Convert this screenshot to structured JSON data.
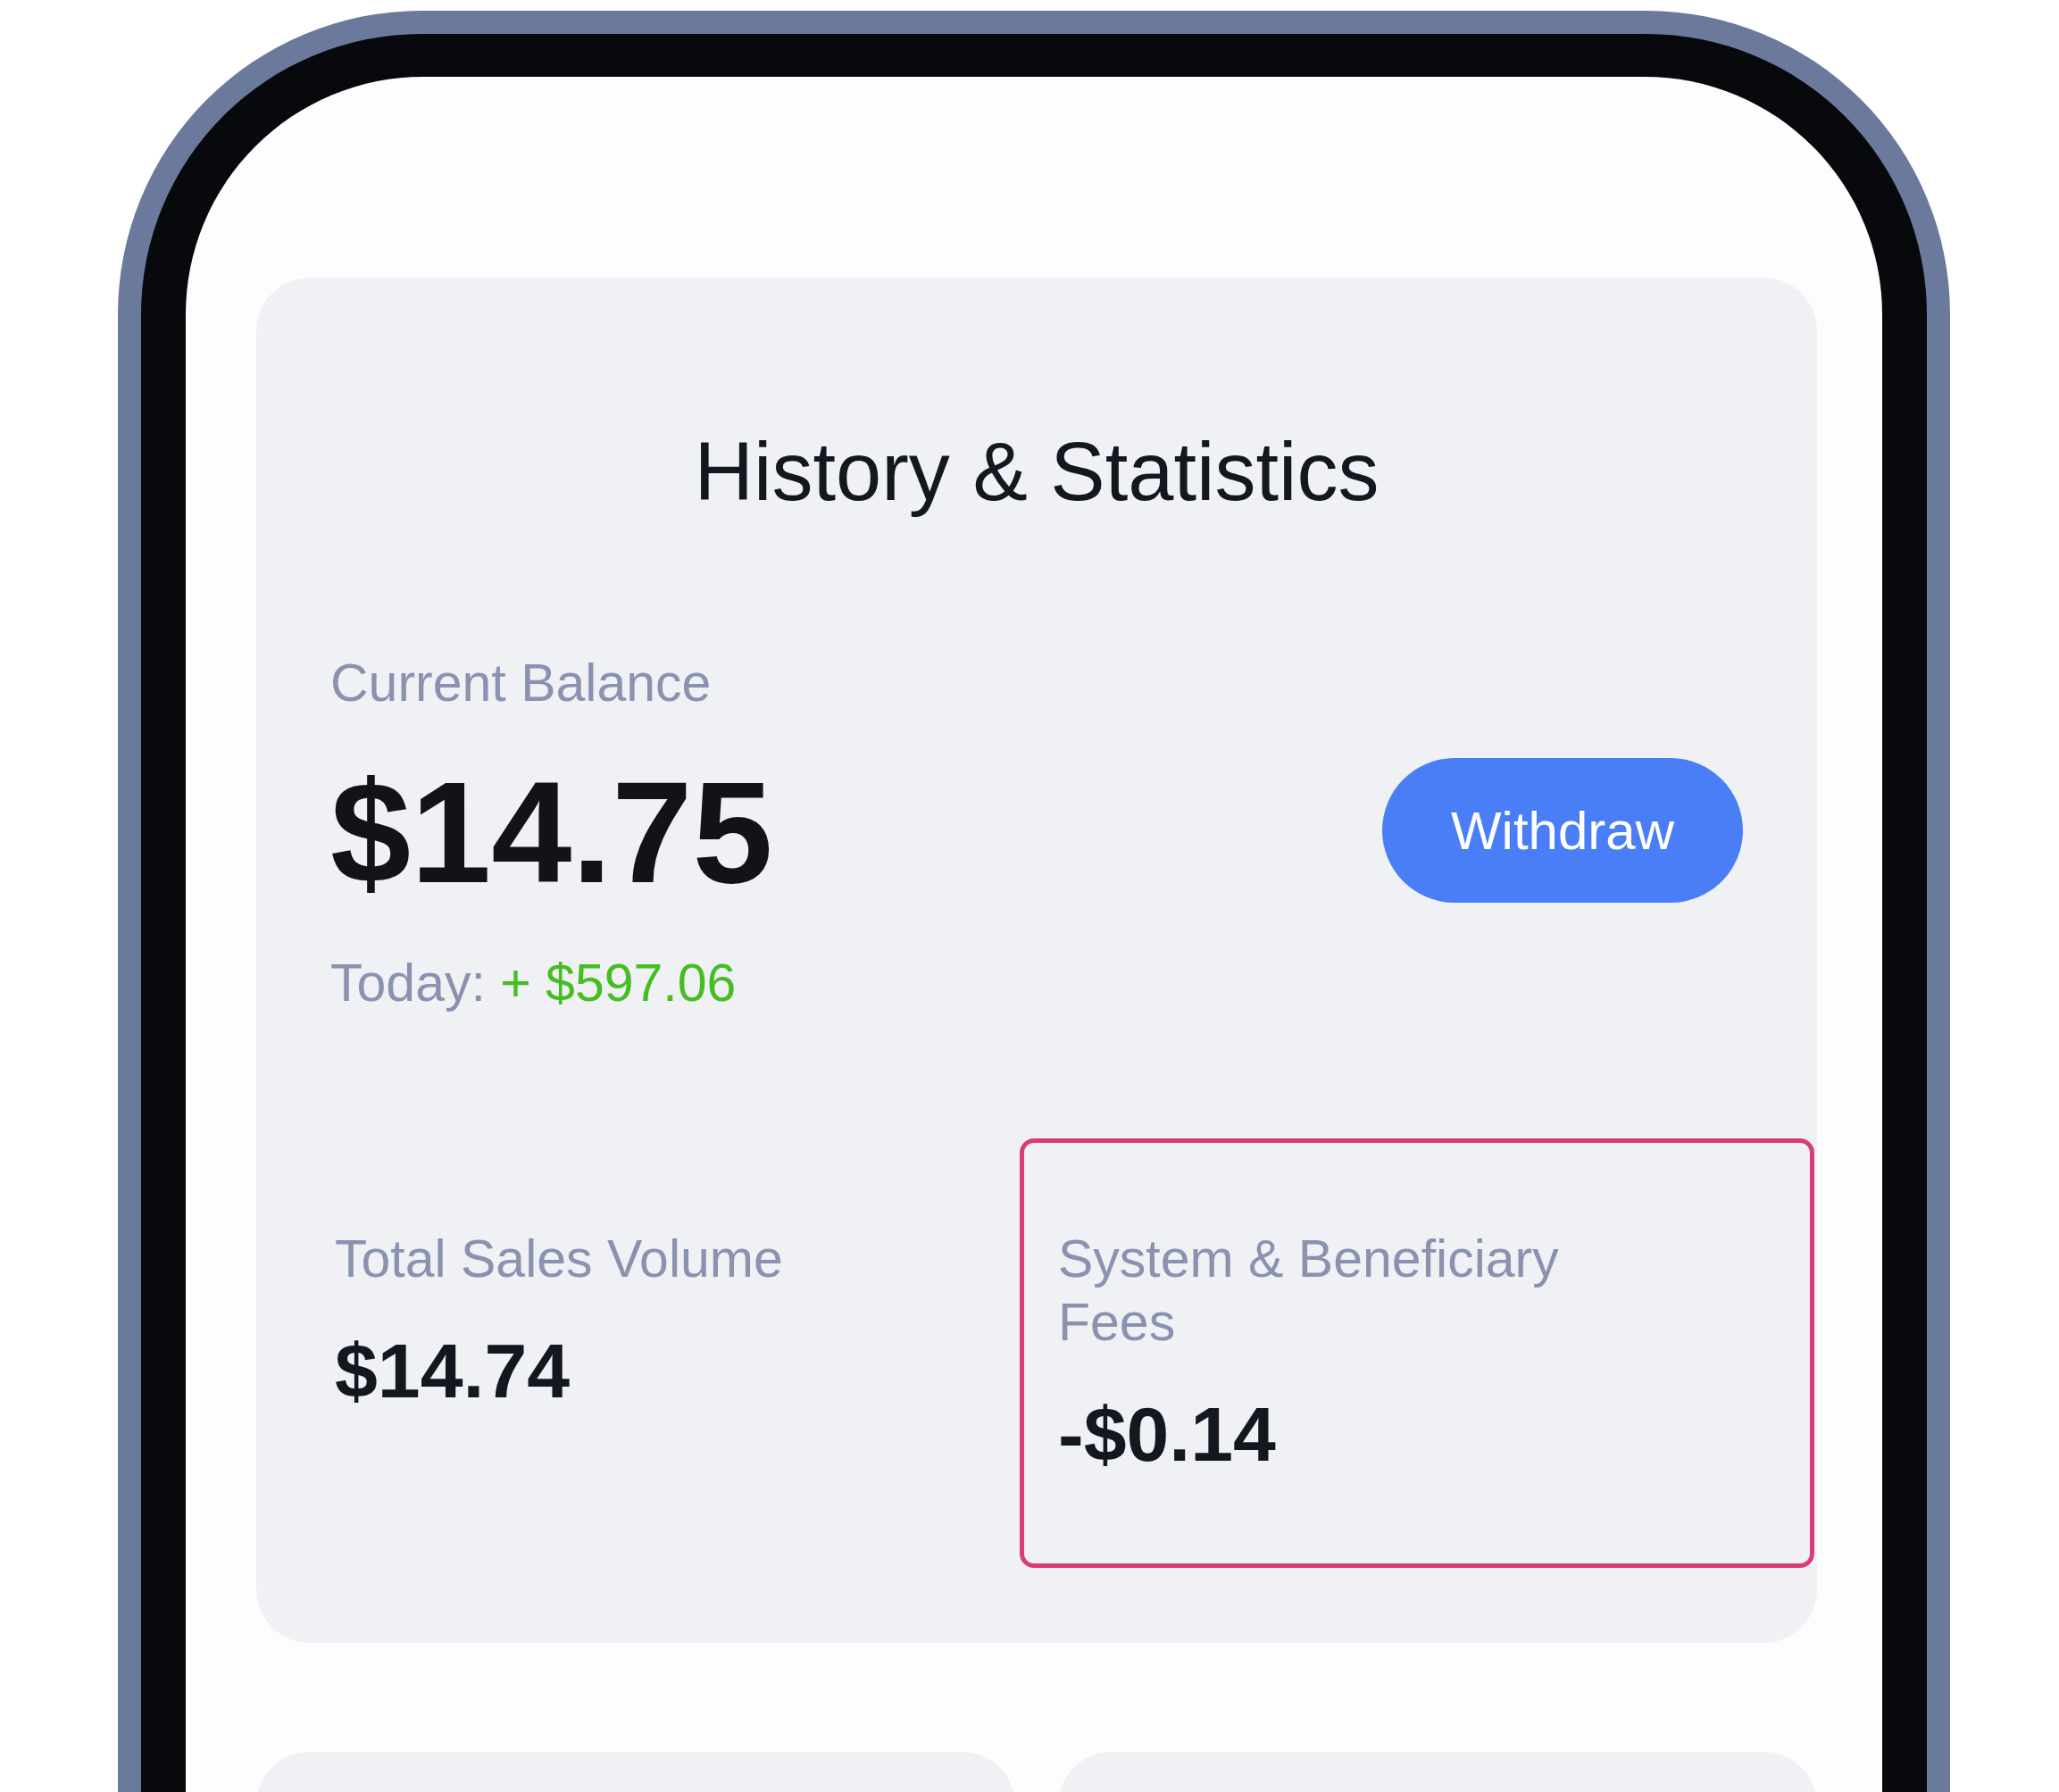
{
  "title": "History & Statistics",
  "balance": {
    "label": "Current Balance",
    "amount": "$14.75",
    "today_label": "Today:",
    "today_change": "+ $597.06"
  },
  "withdraw_button": {
    "label": "Withdraw"
  },
  "stats": [
    {
      "label": "Total Sales Volume",
      "value": "$14.74",
      "highlighted": false
    },
    {
      "label": "System & Beneficiary Fees",
      "value": "-$0.14",
      "highlighted": true
    }
  ]
}
